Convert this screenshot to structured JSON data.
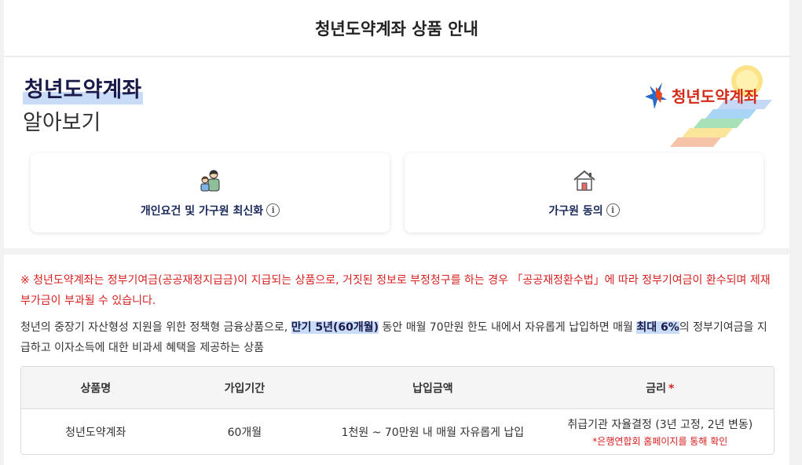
{
  "header": {
    "title": "청년도약계좌 상품 안내"
  },
  "intro": {
    "title": "청년도약계좌",
    "subtitle": "알아보기",
    "logo_text": "청년도약계좌"
  },
  "cards": [
    {
      "label": "개인요건 및 가구원 최신화",
      "icon": "family-icon"
    },
    {
      "label": "가구원 동의",
      "icon": "house-icon"
    }
  ],
  "notice": {
    "warning": "※ 청년도약계좌는 정부기여금(공공재정지급금)이 지급되는 상품으로, 거짓된 정보로 부정청구를 하는 경우 「공공재정환수법」에 따라 정부기여금이 환수되며 제재부가금이 부과될 수 있습니다.",
    "desc_part1": "청년의 중장기 자산형성 지원을 위한 정책형 금융상품으로, ",
    "desc_hl1": "만기 5년(60개월)",
    "desc_part2": " 동안 매월 70만원 한도 내에서 자유롭게 납입하면 매월 ",
    "desc_hl2": "최대 6%",
    "desc_part3": "의 정부기여금을 지급하고 이자소득에 대한 비과세 혜택을 제공하는 상품"
  },
  "table": {
    "headers": [
      "상품명",
      "가입기간",
      "납입금액",
      "금리"
    ],
    "required_mark": "*",
    "row": {
      "name": "청년도약계좌",
      "period": "60개월",
      "amount": "1천원 ~ 70만원 내 매월 자유롭게 납입",
      "rate": "취급기관 자율결정 (3년 고정, 2년 변동)",
      "rate_note": "*은행연합회 홈페이지를 통해 확인"
    }
  },
  "colors": {
    "warning": "#d92020",
    "highlight": "#c8dcf8",
    "title": "#1a1a4a"
  }
}
